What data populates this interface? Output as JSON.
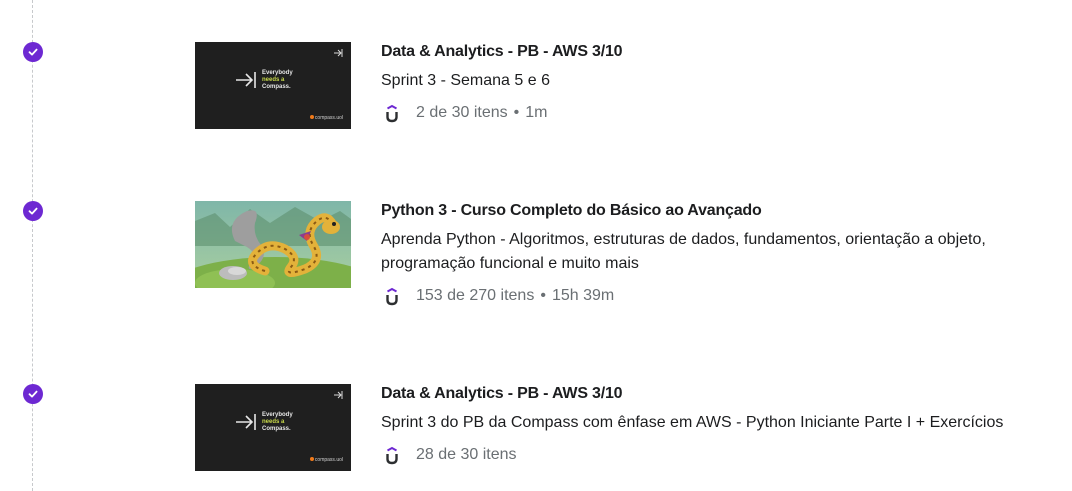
{
  "colors": {
    "check": "#6d28d2",
    "title": "#1c1d1f",
    "meta": "#6a6f73",
    "compass_highlight": "#c8d94a",
    "compass_brand_dot": "#f07a1a"
  },
  "courses": [
    {
      "icon": "check-circle-icon",
      "thumbnail": {
        "kind": "compass",
        "line1": "Everybody",
        "line2": "needs a",
        "line3": "Compass.",
        "brand": "compass.uol"
      },
      "title": "Data & Analytics - PB - AWS 3/10",
      "description": "Sprint 3 - Semana 5 e 6",
      "items": "2 de 30 itens",
      "separator": "•",
      "duration": "1m"
    },
    {
      "icon": "check-circle-icon",
      "thumbnail": {
        "kind": "python"
      },
      "title": "Python 3 - Curso Completo do Básico ao Avançado",
      "description": "Aprenda Python - Algoritmos, estruturas de dados, fundamentos, orientação a objeto, programação funcional e muito mais",
      "items": "153 de 270 itens",
      "separator": "•",
      "duration": "15h 39m"
    },
    {
      "icon": "check-circle-icon",
      "thumbnail": {
        "kind": "compass",
        "line1": "Everybody",
        "line2": "needs a",
        "line3": "Compass.",
        "brand": "compass.uol"
      },
      "title": "Data & Analytics - PB - AWS 3/10",
      "description": "Sprint 3 do PB da Compass com ênfase em AWS - Python Iniciante Parte I + Exercícios",
      "items": "28 de 30 itens"
    }
  ]
}
